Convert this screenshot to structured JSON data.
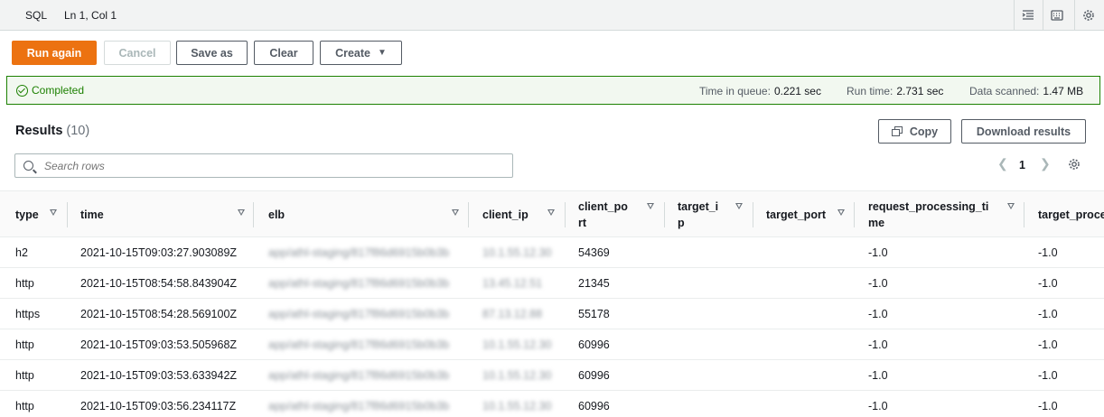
{
  "editor_status": {
    "language": "SQL",
    "cursor": "Ln 1, Col 1",
    "icons": [
      "format-icon",
      "keyboard-icon",
      "settings-icon"
    ]
  },
  "actions": {
    "run_again": "Run again",
    "cancel": "Cancel",
    "save_as": "Save as",
    "clear": "Clear",
    "create": "Create"
  },
  "query_status": {
    "state": "Completed",
    "queue_label": "Time in queue:",
    "queue_value": "0.221 sec",
    "runtime_label": "Run time:",
    "runtime_value": "2.731 sec",
    "scanned_label": "Data scanned:",
    "scanned_value": "1.47 MB"
  },
  "results": {
    "title": "Results",
    "count": "(10)",
    "copy": "Copy",
    "download": "Download results",
    "search_placeholder": "Search rows",
    "page": "1"
  },
  "table": {
    "columns": [
      "type",
      "time",
      "elb",
      "client_ip",
      "client_port",
      "target_ip",
      "target_port",
      "request_processing_time",
      "target_proce"
    ],
    "rows": [
      [
        "h2",
        "2021-10-15T09:03:27.903089Z",
        "app/athl-staging/817f86d6915b0b3b",
        "10.1.55.12.30",
        "54369",
        "",
        "",
        "-1.0",
        "-1.0"
      ],
      [
        "http",
        "2021-10-15T08:54:58.843904Z",
        "app/athl-staging/817f86d6915b0b3b",
        "13.45.12.51",
        "21345",
        "",
        "",
        "-1.0",
        "-1.0"
      ],
      [
        "https",
        "2021-10-15T08:54:28.569100Z",
        "app/athl-staging/817f86d6915b0b3b",
        "87.13.12.88",
        "55178",
        "",
        "",
        "-1.0",
        "-1.0"
      ],
      [
        "http",
        "2021-10-15T09:03:53.505968Z",
        "app/athl-staging/817f86d6915b0b3b",
        "10.1.55.12.30",
        "60996",
        "",
        "",
        "-1.0",
        "-1.0"
      ],
      [
        "http",
        "2021-10-15T09:03:53.633942Z",
        "app/athl-staging/817f86d6915b0b3b",
        "10.1.55.12.30",
        "60996",
        "",
        "",
        "-1.0",
        "-1.0"
      ],
      [
        "http",
        "2021-10-15T09:03:56.234117Z",
        "app/athl-staging/817f86d6915b0b3b",
        "10.1.55.12.30",
        "60996",
        "",
        "",
        "-1.0",
        "-1.0"
      ]
    ]
  }
}
